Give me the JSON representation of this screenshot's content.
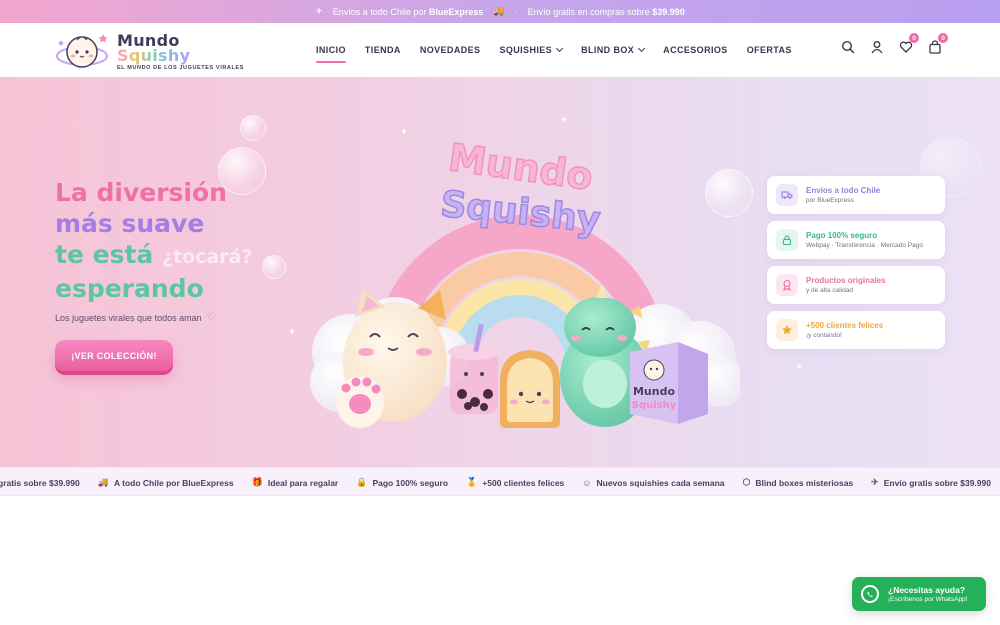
{
  "announcement": {
    "icon1": "✈",
    "part1": "Envíos a todo Chile por",
    "brand": "BlueExpress",
    "icon2": "🚚",
    "separator": "·",
    "part2": "Envío gratis en compras sobre",
    "amount": "$39.990"
  },
  "logo": {
    "word1": "Mundo",
    "word2": "Squishy",
    "tagline": "EL MUNDO DE LOS JUGUETES VIRALES"
  },
  "nav": {
    "items": [
      {
        "label": "INICIO",
        "active": true,
        "dropdown": false
      },
      {
        "label": "TIENDA",
        "active": false,
        "dropdown": false
      },
      {
        "label": "NOVEDADES",
        "active": false,
        "dropdown": false
      },
      {
        "label": "SQUISHIES",
        "active": false,
        "dropdown": true
      },
      {
        "label": "BLIND BOX",
        "active": false,
        "dropdown": true
      },
      {
        "label": "ACCESORIOS",
        "active": false,
        "dropdown": false
      },
      {
        "label": "OFERTAS",
        "active": false,
        "dropdown": false
      }
    ]
  },
  "header_icons": {
    "search": "search-icon",
    "account": "user-icon",
    "wishlist": "heart-icon",
    "wishlist_count": "0",
    "cart": "bag-icon",
    "cart_count": "0"
  },
  "hero": {
    "line1": "La diversión",
    "line2": "más suave",
    "line3": "te está",
    "line4": "esperando",
    "ghost_text": "¿tocará?",
    "subline": "Los juguetes virales que todos aman",
    "subline_icon": "♡",
    "cta": "¡VER COLECCIÓN!",
    "sign_line1": "Mundo",
    "sign_line2": "Squishy",
    "box_line1": "Mundo",
    "box_line2": "Squishy"
  },
  "features": [
    {
      "title": "Envíos a todo Chile",
      "sub": "por BlueExpress",
      "icon": "truck-icon",
      "color": "#9b7de0",
      "bg": "#efe8fb"
    },
    {
      "title": "Pago 100% seguro",
      "sub": "Webpay · Transferencia · Mercado Pago",
      "icon": "lock-icon",
      "color": "#3fb489",
      "bg": "#e4f6ee"
    },
    {
      "title": "Productos originales",
      "sub": "y de alta calidad",
      "icon": "badge-icon",
      "color": "#ee6fa8",
      "bg": "#fce6f0"
    },
    {
      "title": "+500 clientes felices",
      "sub": "¡y contando!",
      "icon": "star-icon",
      "color": "#f0a83a",
      "bg": "#fdf0db"
    }
  ],
  "strip": [
    {
      "icon": "",
      "label": "gratis sobre $39.990"
    },
    {
      "icon": "🚚",
      "label": "A todo Chile por BlueExpress"
    },
    {
      "icon": "🎁",
      "label": "Ideal para regalar"
    },
    {
      "icon": "🔒",
      "label": "Pago 100% seguro"
    },
    {
      "icon": "🏅",
      "label": "+500 clientes felices"
    },
    {
      "icon": "☺",
      "label": "Nuevos squishies cada semana"
    },
    {
      "icon": "⬡",
      "label": "Blind boxes misteriosas"
    },
    {
      "icon": "✈",
      "label": "Envío gratis sobre $39.990"
    },
    {
      "icon": "🚚",
      "label": ""
    }
  ],
  "whatsapp": {
    "title": "¿Necesitas ayuda?",
    "sub": "¡Escríbenos por WhatsApp!"
  }
}
